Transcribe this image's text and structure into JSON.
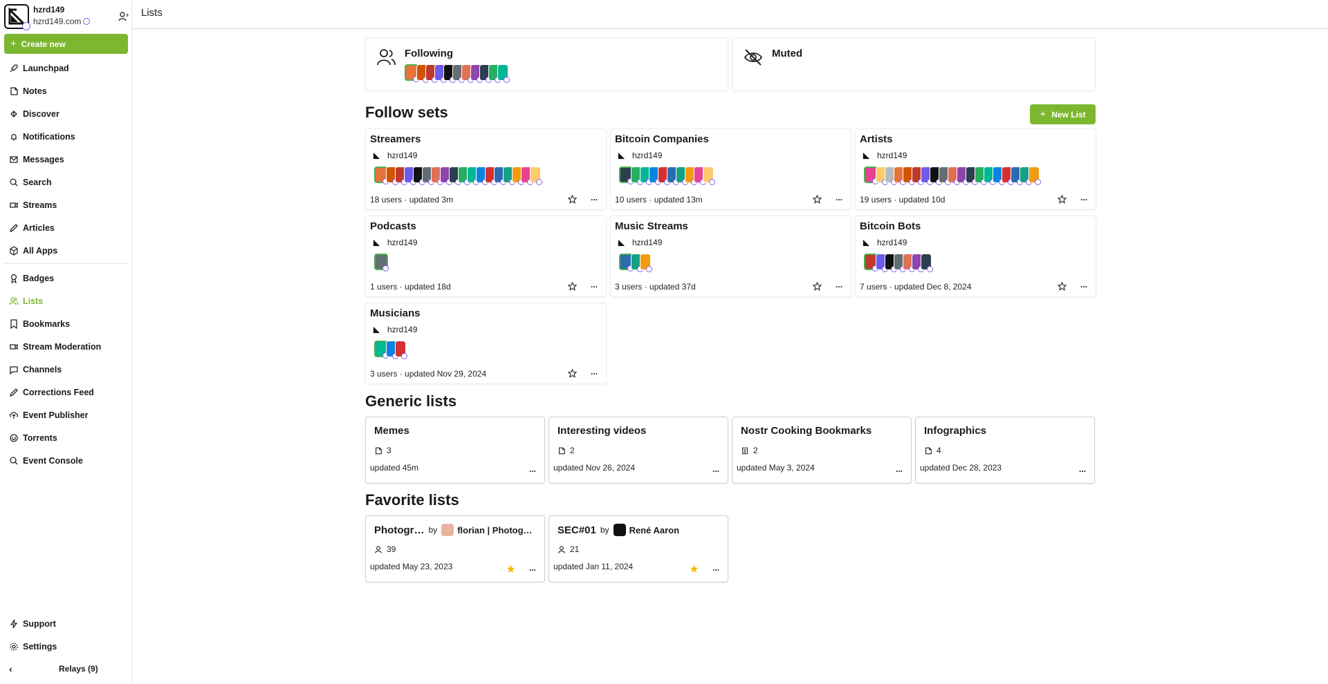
{
  "profile": {
    "name": "hzrd149",
    "nip05": "hzrd149.com"
  },
  "sidebar": {
    "create_label": "Create new",
    "items": [
      {
        "label": "Launchpad",
        "icon": "rocket-icon"
      },
      {
        "label": "Notes",
        "icon": "note-icon"
      },
      {
        "label": "Discover",
        "icon": "discover-icon"
      },
      {
        "label": "Notifications",
        "icon": "bell-icon"
      },
      {
        "label": "Messages",
        "icon": "mail-icon"
      },
      {
        "label": "Search",
        "icon": "search-icon"
      },
      {
        "label": "Streams",
        "icon": "video-icon"
      },
      {
        "label": "Articles",
        "icon": "pen-icon"
      },
      {
        "label": "All Apps",
        "icon": "box-icon"
      },
      {
        "label": "Badges",
        "icon": "badge-icon"
      },
      {
        "label": "Lists",
        "icon": "users-icon"
      },
      {
        "label": "Bookmarks",
        "icon": "bookmark-icon"
      },
      {
        "label": "Stream Moderation",
        "icon": "video-icon"
      },
      {
        "label": "Channels",
        "icon": "chat-icon"
      },
      {
        "label": "Corrections Feed",
        "icon": "pen-icon"
      },
      {
        "label": "Event Publisher",
        "icon": "upload-icon"
      },
      {
        "label": "Torrents",
        "icon": "torrent-icon"
      },
      {
        "label": "Event Console",
        "icon": "search-icon"
      },
      {
        "label": "Support",
        "icon": "lightning-icon"
      },
      {
        "label": "Settings",
        "icon": "gear-icon"
      }
    ],
    "relays_label": "Relays (9)"
  },
  "header": {
    "title": "Lists"
  },
  "top_cards": {
    "following": "Following",
    "muted": "Muted"
  },
  "sections": {
    "follow_sets": "Follow sets",
    "generic_lists": "Generic lists",
    "favorite_lists": "Favorite lists",
    "new_list": "New List"
  },
  "follow_sets": [
    {
      "title": "Streamers",
      "owner": "hzrd149",
      "meta": "18 users · updated 3m"
    },
    {
      "title": "Bitcoin Companies",
      "owner": "hzrd149",
      "meta": "10 users · updated 13m"
    },
    {
      "title": "Artists",
      "owner": "hzrd149",
      "meta": "19 users · updated 10d"
    },
    {
      "title": "Podcasts",
      "owner": "hzrd149",
      "meta": "1 users · updated 18d"
    },
    {
      "title": "Music Streams",
      "owner": "hzrd149",
      "meta": "3 users · updated 37d"
    },
    {
      "title": "Bitcoin Bots",
      "owner": "hzrd149",
      "meta": "7 users · updated Dec 8, 2024"
    },
    {
      "title": "Musicians",
      "owner": "hzrd149",
      "meta": "3 users · updated Nov 29, 2024"
    }
  ],
  "generic_lists": [
    {
      "title": "Memes",
      "count": "3",
      "updated": "updated 45m",
      "icon": "file-icon"
    },
    {
      "title": "Interesting videos",
      "count": "2",
      "updated": "updated Nov 26, 2024",
      "icon": "file-icon"
    },
    {
      "title": "Nostr Cooking Bookmarks",
      "count": "2",
      "updated": "updated May 3, 2024",
      "icon": "note-list-icon"
    },
    {
      "title": "Infographics",
      "count": "4",
      "updated": "updated Dec 28, 2023",
      "icon": "file-icon"
    }
  ],
  "favorite_lists": [
    {
      "title": "Photogr…",
      "by": "by",
      "author": "florian | Photog…",
      "count": "39",
      "updated": "updated May 23, 2023"
    },
    {
      "title": "SEC#01",
      "by": "by",
      "author": "René Aaron",
      "count": "21",
      "updated": "updated Jan 11, 2024"
    }
  ],
  "more_label": "...",
  "colors": {
    "accent": "#7cb72f",
    "star": "#f5b800",
    "verified": "#8a5cf6"
  }
}
